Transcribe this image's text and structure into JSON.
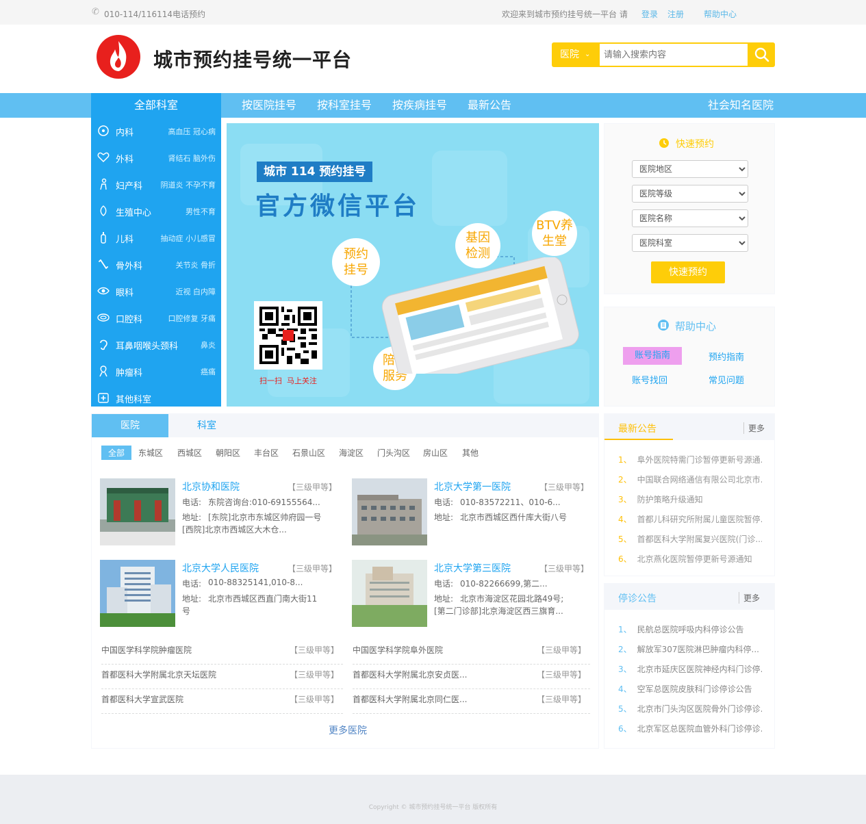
{
  "topbar": {
    "phone": "010-114/116114电话预约",
    "welcome": "欢迎来到城市预约挂号统一平台 请",
    "login": "登录",
    "register": "注册",
    "help": "帮助中心"
  },
  "header": {
    "site_title": "城市预约挂号统一平台",
    "search_category": "医院",
    "search_placeholder": "请输入搜索内容"
  },
  "nav": {
    "all_departments": "全部科室",
    "items": [
      "按医院挂号",
      "按科室挂号",
      "按疾病挂号",
      "最新公告"
    ],
    "right": "社会知名医院"
  },
  "sidebar": {
    "items": [
      {
        "name": "内科",
        "sub": "高血压 冠心病"
      },
      {
        "name": "外科",
        "sub": "肾结石 脑外伤"
      },
      {
        "name": "妇产科",
        "sub": "阴道炎 不孕不育"
      },
      {
        "name": "生殖中心",
        "sub": "男性不育"
      },
      {
        "name": "儿科",
        "sub": "抽动症 小儿感冒"
      },
      {
        "name": "骨外科",
        "sub": "关节炎 骨折"
      },
      {
        "name": "眼科",
        "sub": "近视 白内障"
      },
      {
        "name": "口腔科",
        "sub": "口腔修复 牙痛"
      },
      {
        "name": "耳鼻咽喉头颈科",
        "sub": "鼻炎"
      },
      {
        "name": "肿瘤科",
        "sub": "癌痛"
      },
      {
        "name": "其他科室",
        "sub": ""
      }
    ]
  },
  "banner": {
    "tag": "城市 114 预约挂号",
    "headline": "官方微信平台",
    "bubble1": "预约挂号",
    "bubble2": "基因检测",
    "bubble3": "BTV养生堂",
    "bubble4": "陪诊服务",
    "qr_caption1": "扫一扫",
    "qr_caption2": "马上关注"
  },
  "quick": {
    "title": "快速预约",
    "selects": [
      "医院地区",
      "医院等级",
      "医院名称",
      "医院科室"
    ],
    "submit": "快速预约"
  },
  "help": {
    "title": "帮助中心",
    "links": [
      "账号指南",
      "预约指南",
      "账号找回",
      "常见问题"
    ]
  },
  "tabs": {
    "hospital": "医院",
    "department": "科室"
  },
  "districts": [
    "全部",
    "东城区",
    "西城区",
    "朝阳区",
    "丰台区",
    "石景山区",
    "海淀区",
    "门头沟区",
    "房山区",
    "其他"
  ],
  "hospitals": [
    {
      "name": "北京协和医院",
      "grade": "【三级甲等】",
      "phone_label": "电话:",
      "phone": "东院咨询台:010-69155564...",
      "addr_label": "地址:",
      "addr": "[东院]北京市东城区帅府园一号",
      "addr2": "[西院]北京市西城区大木仓..."
    },
    {
      "name": "北京大学第一医院",
      "grade": "【三级甲等】",
      "phone_label": "电话:",
      "phone": "010-83572211、010-6...",
      "addr_label": "地址:",
      "addr": "北京市西城区西什库大街八号",
      "addr2": ""
    },
    {
      "name": "北京大学人民医院",
      "grade": "【三级甲等】",
      "phone_label": "电话:",
      "phone": "010-88325141,010-8...",
      "addr_label": "地址:",
      "addr": "北京市西城区西直门南大街11",
      "addr2": "号"
    },
    {
      "name": "北京大学第三医院",
      "grade": "【三级甲等】",
      "phone_label": "电话:",
      "phone": "010-82266699,第二...",
      "addr_label": "地址:",
      "addr": "北京市海淀区花园北路49号;",
      "addr2": "[第二门诊部]北京海淀区西三旗育..."
    }
  ],
  "plain_hospitals": [
    {
      "name": "中国医学科学院肿瘤医院",
      "grade": "【三级甲等】"
    },
    {
      "name": "中国医学科学院阜外医院",
      "grade": "【三级甲等】"
    },
    {
      "name": "首都医科大学附属北京天坛医院",
      "grade": "【三级甲等】"
    },
    {
      "name": "首都医科大学附属北京安贞医...",
      "grade": "【三级甲等】"
    },
    {
      "name": "首都医科大学宣武医院",
      "grade": "【三级甲等】"
    },
    {
      "name": "首都医科大学附属北京同仁医...",
      "grade": "【三级甲等】"
    }
  ],
  "more_hospitals": "更多医院",
  "latest": {
    "title": "最新公告",
    "more": "更多",
    "items": [
      "阜外医院特需门诊暂停更新号源通...",
      "中国联合网络通信有限公司北京市...",
      "防护策略升级通知",
      "首都儿科研究所附属儿童医院暂停...",
      "首都医科大学附属复兴医院(门诊...",
      "北京燕化医院暂停更新号源通知"
    ]
  },
  "stop": {
    "title": "停诊公告",
    "more": "更多",
    "items": [
      "民航总医院呼吸内科停诊公告",
      "解放军307医院淋巴肿瘤内科停...",
      "北京市延庆区医院神经内科门诊停...",
      "空军总医院皮肤科门诊停诊公告",
      "北京市门头沟区医院骨外门诊停诊...",
      "北京军区总医院血管外科门诊停诊..."
    ]
  },
  "footer": {
    "copyright": "Copyright © 城市预约挂号统一平台 版权所有"
  },
  "colors": {
    "nav_blue": "#60bff2",
    "sidebar_blue": "#1fa4f0",
    "accent_yellow": "#fecd09",
    "banner_blue": "#8bddf3",
    "link_blue": "#5084c4"
  }
}
